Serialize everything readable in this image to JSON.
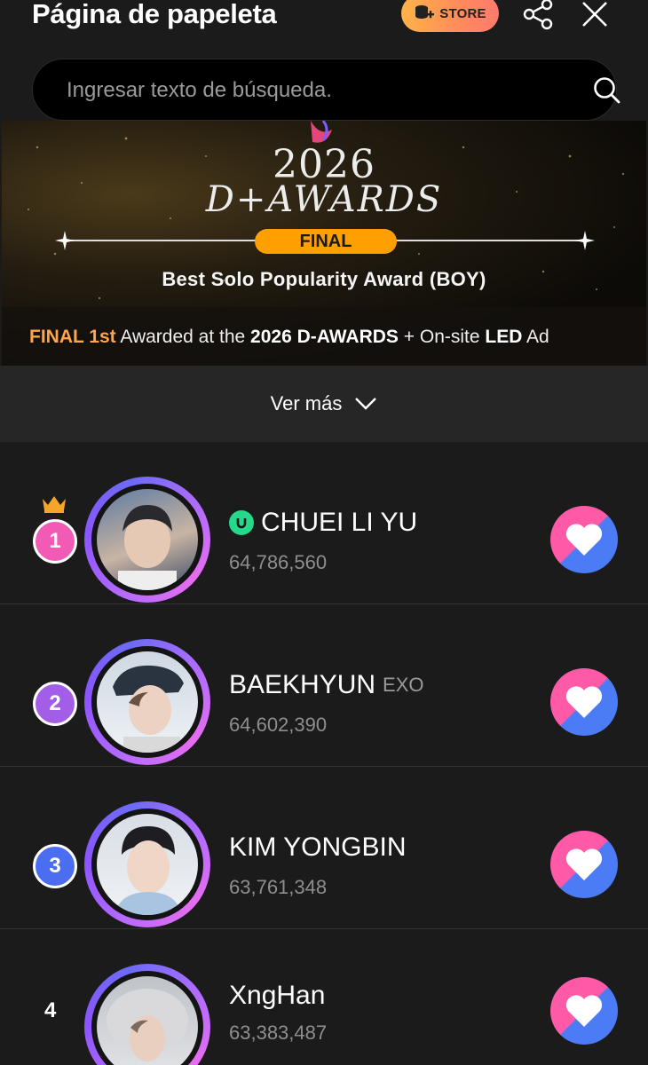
{
  "header": {
    "title": "Página de papeleta",
    "store_label": "STORE"
  },
  "search": {
    "placeholder": "Ingresar texto de búsqueda."
  },
  "banner": {
    "year": "2026",
    "event": "D+AWARDS",
    "stage": "FINAL",
    "award": "Best Solo Popularity Award (BOY)",
    "bottom_highlight": "FINAL 1st",
    "bottom_part1": " Awarded at the ",
    "bottom_bold1": "2026 D-AWARDS",
    "bottom_part2": " + On-site ",
    "bottom_bold2": "LED",
    "bottom_part3": " Ad"
  },
  "more": {
    "label": "Ver más"
  },
  "ranking": [
    {
      "rank": "1",
      "name": "CHUEI LI YU",
      "group": "",
      "votes": "64,786,560",
      "verified": true,
      "badge_color": "#f15bb5"
    },
    {
      "rank": "2",
      "name": "BAEKHYUN",
      "group": "EXO",
      "votes": "64,602,390",
      "verified": false,
      "badge_color": "#a35ee8"
    },
    {
      "rank": "3",
      "name": "KIM YONGBIN",
      "group": "",
      "votes": "63,761,348",
      "verified": false,
      "badge_color": "#4b6ef0"
    },
    {
      "rank": "4",
      "name": "XngHan",
      "group": "",
      "votes": "63,383,487",
      "verified": false,
      "badge_color": ""
    }
  ],
  "colors": {
    "accent_pink": "#ff5aa8",
    "accent_blue": "#4b7bf5",
    "store_orange": "#ffa000",
    "verified_green": "#24d98a"
  }
}
